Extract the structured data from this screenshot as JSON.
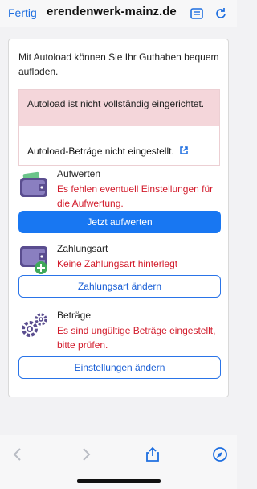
{
  "browser": {
    "done_label": "Fertig",
    "url": "erendenwerk-mainz.de"
  },
  "card": {
    "intro": "Mit Autoload können Sie Ihr Guthaben bequem aufladen.",
    "alert": {
      "message": "Autoload ist nicht vollständig eingerichtet.",
      "link": "Autoload-Beträge nicht eingestellt."
    },
    "sections": {
      "aufwerten": {
        "title": "Aufwerten",
        "error": "Es fehlen eventuell Einstellungen für die Aufwertung.",
        "button": "Jetzt aufwerten"
      },
      "zahlungsart": {
        "title": "Zahlungsart",
        "error": "Keine Zahlungsart hinterlegt",
        "button": "Zahlungsart ändern"
      },
      "betraege": {
        "title": "Beträge",
        "error": "Es sind ungültige Beträge eingestellt, bitte prüfen.",
        "button": "Einstellungen ändern"
      }
    }
  },
  "colors": {
    "accent": "#1877f2",
    "error": "#d21b2b",
    "alert_bg": "#f4d6da",
    "icon_purple": "#5a4d8f"
  }
}
